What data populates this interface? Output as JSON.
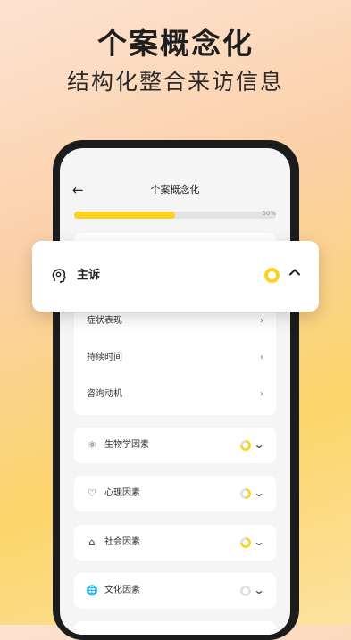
{
  "hero": {
    "title": "个案概念化",
    "subtitle": "结构化整合来访信息"
  },
  "topbar": {
    "back_icon": "arrow-left-icon",
    "title": "个案概念化"
  },
  "progress": {
    "value": 0.5,
    "label": "50%"
  },
  "popup": {
    "icon": "head-brain-icon",
    "label": "主诉",
    "status": "in-progress",
    "expand_icon": "chevron-up-icon"
  },
  "chief_complaint": {
    "items": [
      {
        "label": "症状表现"
      },
      {
        "label": "持续时间"
      },
      {
        "label": "咨询动机"
      }
    ]
  },
  "sections": [
    {
      "icon": "dna-person-icon",
      "label": "生物学因素",
      "progress": 0.75
    },
    {
      "icon": "heart-person-icon",
      "label": "心理因素",
      "progress": 0.5
    },
    {
      "icon": "house-icon",
      "label": "社会因素",
      "progress": 0.75
    },
    {
      "icon": "globe-icon",
      "label": "文化因素",
      "progress": 0
    }
  ],
  "colors": {
    "accent": "#fcd21f",
    "ring_track": "#e0e0e0"
  }
}
